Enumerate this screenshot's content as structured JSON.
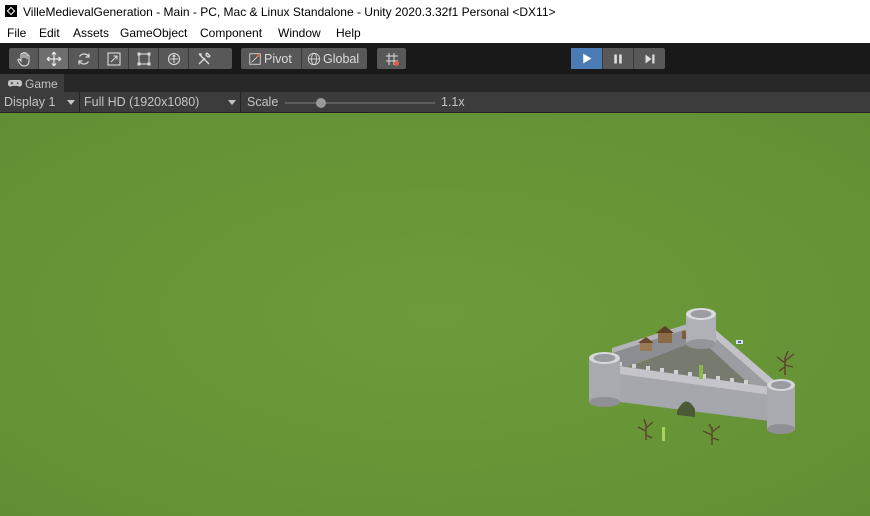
{
  "window": {
    "title": "VilleMedievalGeneration - Main - PC, Mac & Linux Standalone - Unity 2020.3.32f1 Personal <DX11>"
  },
  "menu": [
    "File",
    "Edit",
    "Assets",
    "GameObject",
    "Component",
    "Window",
    "Help"
  ],
  "toolbar": {
    "tools": [
      "hand-icon",
      "move-icon",
      "rotate-icon",
      "scale-icon",
      "rect-icon",
      "transform-icon",
      "custom-tools-icon"
    ],
    "active_tool": "move-icon",
    "pivot_label": "Pivot",
    "global_label": "Global",
    "snap_icon": "grid-snap-icon",
    "playback": [
      "play-icon",
      "pause-icon",
      "step-icon"
    ]
  },
  "game_tab": {
    "label": "Game",
    "icon": "gamepad-icon"
  },
  "game_view": {
    "display": "Display 1",
    "resolution": "Full HD (1920x1080)",
    "scale_label": "Scale",
    "scale_value": "1.1x",
    "scale_fraction": 0.24
  },
  "colors": {
    "play_accent": "#4a7bb5",
    "ground": "#689637",
    "toolbar_bg": "#191919",
    "panel_bg": "#3c3c3c"
  }
}
